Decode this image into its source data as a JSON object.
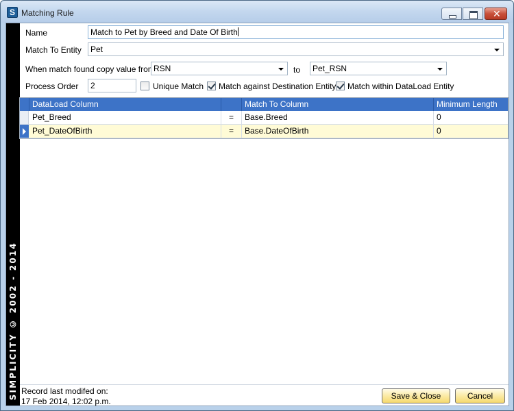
{
  "window": {
    "title": "Matching Rule",
    "app_icon_letter": "S"
  },
  "brand": "SIMPLICITY © 2002 - 2014",
  "form": {
    "name_label": "Name",
    "name_value": "Match to Pet by Breed and Date Of Birth",
    "entity_label": "Match To Entity",
    "entity_value": "Pet",
    "copy_label": "When match found copy value from",
    "copy_from_value": "RSN",
    "to_label": "to",
    "copy_to_value": "Pet_RSN",
    "process_order_label": "Process Order",
    "process_order_value": "2",
    "unique_match_label": "Unique Match",
    "unique_match_checked": false,
    "match_dest_label": "Match against Destination Entity",
    "match_dest_checked": true,
    "match_within_label": "Match within DataLoad Entity",
    "match_within_checked": true
  },
  "grid": {
    "columns": [
      "DataLoad Column",
      "",
      "Match To Column",
      "Minimum Length"
    ],
    "rows": [
      {
        "dataload": "Pet_Breed",
        "op": "=",
        "match_to": "Base.Breed",
        "min_length": "0",
        "selected": false
      },
      {
        "dataload": "Pet_DateOfBirth",
        "op": "=",
        "match_to": "Base.DateOfBirth",
        "min_length": "0",
        "selected": true
      }
    ]
  },
  "footer": {
    "modified_label": "Record last modifed on:",
    "modified_value": "17 Feb 2014, 12:02 p.m.",
    "save_label": "Save & Close",
    "cancel_label": "Cancel"
  }
}
